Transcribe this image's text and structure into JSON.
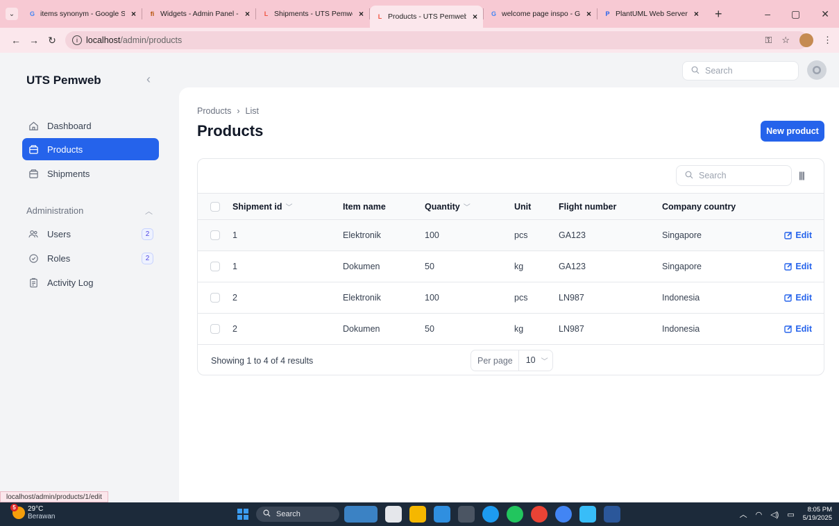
{
  "browser": {
    "tabs": [
      {
        "title": "items synonym - Google S",
        "favicon": "G",
        "color": "#4285f4"
      },
      {
        "title": "Widgets - Admin Panel - F",
        "favicon": "fi",
        "color": "#b45309"
      },
      {
        "title": "Shipments - UTS Pemweb",
        "favicon": "L",
        "color": "#f05340"
      },
      {
        "title": "Products - UTS Pemweb",
        "favicon": "L",
        "color": "#f05340",
        "active": true
      },
      {
        "title": "welcome page inspo - Goo",
        "favicon": "G",
        "color": "#4285f4"
      },
      {
        "title": "PlantUML Web Server",
        "favicon": "P",
        "color": "#2563eb"
      }
    ],
    "url_host": "localhost",
    "url_path": "/admin/products",
    "status_url": "localhost/admin/products/1/edit"
  },
  "sidebar": {
    "brand": "UTS Pemweb",
    "items": [
      {
        "label": "Dashboard",
        "icon": "home-icon",
        "active": false
      },
      {
        "label": "Products",
        "icon": "box-icon",
        "active": true
      },
      {
        "label": "Shipments",
        "icon": "box-icon",
        "active": false
      }
    ],
    "group_label": "Administration",
    "admin_items": [
      {
        "label": "Users",
        "icon": "users-icon",
        "badge": "2"
      },
      {
        "label": "Roles",
        "icon": "shield-check-icon",
        "badge": "2"
      },
      {
        "label": "Activity Log",
        "icon": "clipboard-icon",
        "badge": ""
      }
    ]
  },
  "topbar": {
    "search_placeholder": "Search"
  },
  "page": {
    "breadcrumb": [
      "Products",
      "List"
    ],
    "title": "Products",
    "new_button": "New product"
  },
  "table": {
    "search_placeholder": "Search",
    "columns": [
      "Shipment id",
      "Item name",
      "Quantity",
      "Unit",
      "Flight number",
      "Company country"
    ],
    "rows": [
      {
        "shipment_id": "1",
        "item_name": "Elektronik",
        "quantity": "100",
        "unit": "pcs",
        "flight_number": "GA123",
        "company_country": "Singapore"
      },
      {
        "shipment_id": "1",
        "item_name": "Dokumen",
        "quantity": "50",
        "unit": "kg",
        "flight_number": "GA123",
        "company_country": "Singapore"
      },
      {
        "shipment_id": "2",
        "item_name": "Elektronik",
        "quantity": "100",
        "unit": "pcs",
        "flight_number": "LN987",
        "company_country": "Indonesia"
      },
      {
        "shipment_id": "2",
        "item_name": "Dokumen",
        "quantity": "50",
        "unit": "kg",
        "flight_number": "LN987",
        "company_country": "Indonesia"
      }
    ],
    "edit_label": "Edit",
    "showing": "Showing 1 to 4 of 4 results",
    "per_page_label": "Per page",
    "per_page_value": "10"
  },
  "taskbar": {
    "weather_temp": "29°C",
    "weather_desc": "Berawan",
    "weather_badge": "5",
    "search_label": "Search",
    "time": "8:05 PM",
    "date": "5/19/2025"
  },
  "colors": {
    "accent": "#2563eb",
    "tabbar": "#f7c9d3"
  }
}
